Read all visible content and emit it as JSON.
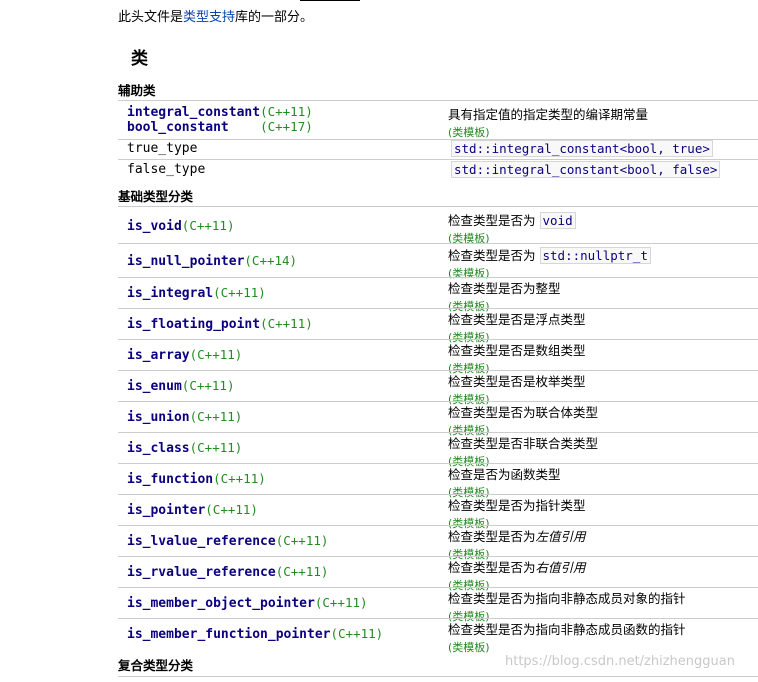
{
  "intro": {
    "prefix": "此头文件是",
    "link": "类型支持",
    "suffix": "库的一部分。"
  },
  "section_title": "类",
  "helper": {
    "title": "辅助类",
    "rows": [
      {
        "name1": "integral_constant",
        "ver1": "(C++11)",
        "name2": "bool_constant",
        "ver2": "(C++17)",
        "desc": "具有指定值的指定类型的编译期常量",
        "tag": "(类模板)"
      },
      {
        "name": "true_type",
        "code": "std::integral_constant<bool, true>"
      },
      {
        "name": "false_type",
        "code": "std::integral_constant<bool, false>"
      }
    ]
  },
  "primary": {
    "title": "基础类型分类",
    "rows": [
      {
        "name": "is_void",
        "ver": "(C++11)",
        "desc": "检查类型是否为",
        "code": "void",
        "tag": "(类模板)"
      },
      {
        "name": "is_null_pointer",
        "ver": "(C++14)",
        "desc": "检查类型是否为",
        "code": "std::nullptr_t",
        "tag": "(类模板)"
      },
      {
        "name": "is_integral",
        "ver": "(C++11)",
        "desc": "检查类型是否为整型",
        "tag": "(类模板)"
      },
      {
        "name": "is_floating_point",
        "ver": "(C++11)",
        "desc": "检查类型是否是浮点类型",
        "tag": "(类模板)"
      },
      {
        "name": "is_array",
        "ver": "(C++11)",
        "desc": "检查类型是否是数组类型",
        "tag": "(类模板)"
      },
      {
        "name": "is_enum",
        "ver": "(C++11)",
        "desc": "检查类型是否是枚举类型",
        "tag": "(类模板)"
      },
      {
        "name": "is_union",
        "ver": "(C++11)",
        "desc": "检查类型是否为联合体类型",
        "tag": "(类模板)"
      },
      {
        "name": "is_class",
        "ver": "(C++11)",
        "desc": "检查类型是否非联合类类型",
        "tag": "(类模板)"
      },
      {
        "name": "is_function",
        "ver": "(C++11)",
        "desc": "检查是否为函数类型",
        "tag": "(类模板)"
      },
      {
        "name": "is_pointer",
        "ver": "(C++11)",
        "desc": "检查类型是否为指针类型",
        "tag": "(类模板)"
      },
      {
        "name": "is_lvalue_reference",
        "ver": "(C++11)",
        "desc": "检查类型是否为",
        "em": "左值引用",
        "tag": "(类模板)"
      },
      {
        "name": "is_rvalue_reference",
        "ver": "(C++11)",
        "desc": "检查类型是否为",
        "em": "右值引用",
        "tag": "(类模板)"
      },
      {
        "name": "is_member_object_pointer",
        "ver": "(C++11)",
        "desc": "检查类型是否为指向非静态成员对象的指针",
        "tag": "(类模板)"
      },
      {
        "name": "is_member_function_pointer",
        "ver": "(C++11)",
        "desc": "检查类型是否为指向非静态成员函数的指针",
        "tag": "(类模板)"
      }
    ]
  },
  "composite": {
    "title": "复合类型分类"
  },
  "watermark": "https://blog.csdn.net/zhizhengguan"
}
